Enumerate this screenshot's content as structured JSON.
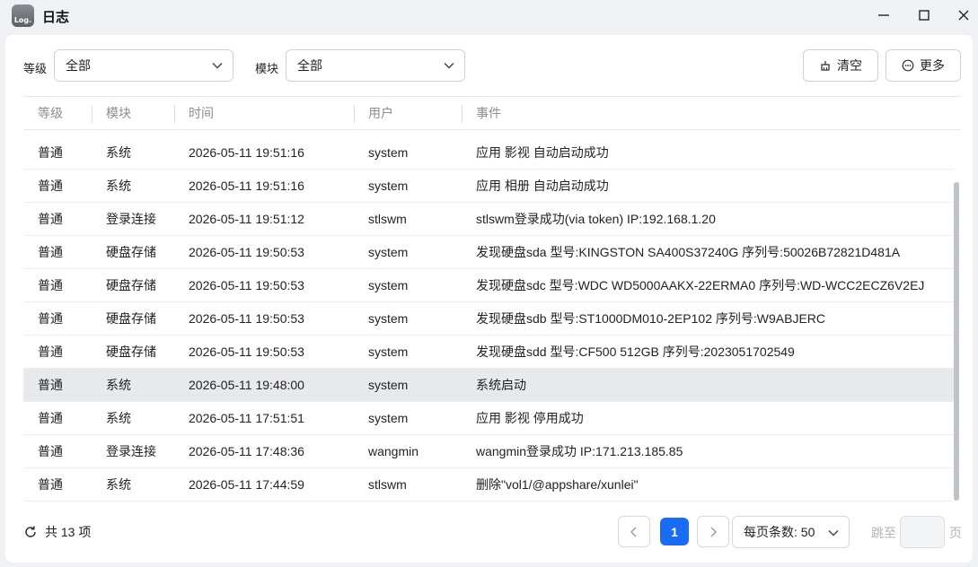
{
  "window": {
    "app_icon_text": "Log.",
    "title": "日志"
  },
  "filters": {
    "level_label": "等级",
    "level_value": "全部",
    "module_label": "模块",
    "module_value": "全部"
  },
  "actions": {
    "clear_label": "清空",
    "more_label": "更多"
  },
  "table": {
    "columns": [
      "等级",
      "模块",
      "时间",
      "用户",
      "事件"
    ],
    "rows": [
      {
        "level": "普通",
        "module": "系统",
        "time": "2026-05-11 19:51:16",
        "user": "system",
        "event": "应用 影视 自动启动成功"
      },
      {
        "level": "普通",
        "module": "系统",
        "time": "2026-05-11 19:51:16",
        "user": "system",
        "event": "应用 相册 自动启动成功"
      },
      {
        "level": "普通",
        "module": "登录连接",
        "time": "2026-05-11 19:51:12",
        "user": "stlswm",
        "event": "stlswm登录成功(via token) IP:192.168.1.20"
      },
      {
        "level": "普通",
        "module": "硬盘存储",
        "time": "2026-05-11 19:50:53",
        "user": "system",
        "event": "发现硬盘sda 型号:KINGSTON SA400S37240G 序列号:50026B72821D481A"
      },
      {
        "level": "普通",
        "module": "硬盘存储",
        "time": "2026-05-11 19:50:53",
        "user": "system",
        "event": "发现硬盘sdc 型号:WDC WD5000AAKX-22ERMA0 序列号:WD-WCC2ECZ6V2EJ"
      },
      {
        "level": "普通",
        "module": "硬盘存储",
        "time": "2026-05-11 19:50:53",
        "user": "system",
        "event": "发现硬盘sdb 型号:ST1000DM010-2EP102 序列号:W9ABJERC"
      },
      {
        "level": "普通",
        "module": "硬盘存储",
        "time": "2026-05-11 19:50:53",
        "user": "system",
        "event": "发现硬盘sdd 型号:CF500 512GB 序列号:2023051702549"
      },
      {
        "level": "普通",
        "module": "系统",
        "time": "2026-05-11 19:48:00",
        "user": "system",
        "event": "系统启动"
      },
      {
        "level": "普通",
        "module": "系统",
        "time": "2026-05-11 17:51:51",
        "user": "system",
        "event": "应用 影视 停用成功"
      },
      {
        "level": "普通",
        "module": "登录连接",
        "time": "2026-05-11 17:48:36",
        "user": "wangmin",
        "event": "wangmin登录成功 IP:171.213.185.85"
      },
      {
        "level": "普通",
        "module": "系统",
        "time": "2026-05-11 17:44:59",
        "user": "stlswm",
        "event": "删除\"vol1/@appshare/xunlei\""
      }
    ]
  },
  "footer": {
    "total_label": "共 13 项",
    "current_page": "1",
    "per_page_label": "每页条数: 50",
    "jump_label": "跳至",
    "page_unit": "页"
  },
  "colors": {
    "accent": "#1a6cf5",
    "selected_row": "#e8e9ec"
  }
}
